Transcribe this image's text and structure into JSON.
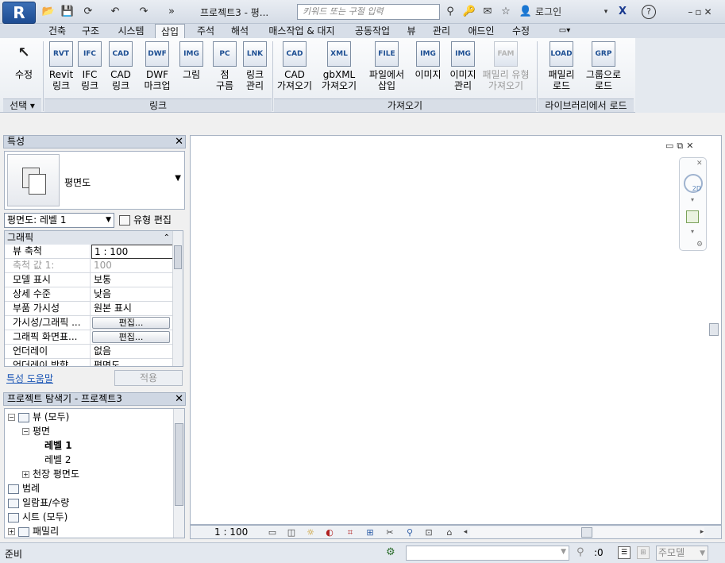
{
  "title": {
    "project": "프로젝트3 - 평...",
    "search_placeholder": "키워드 또는 구절 입력",
    "login": "로그인",
    "help": "?"
  },
  "tabs": [
    "건축",
    "구조",
    "시스템",
    "삽입",
    "주석",
    "해석",
    "매스작업 & 대지",
    "공동작업",
    "뷰",
    "관리",
    "애드인",
    "수정"
  ],
  "active_tab": "삽입",
  "ribbon": {
    "modify": "수정",
    "modify_panel": "선택 ▾",
    "link_buttons": [
      {
        "label": "Revit\n링크",
        "icon": "RVT"
      },
      {
        "label": "IFC\n링크",
        "icon": "IFC"
      },
      {
        "label": "CAD\n링크",
        "icon": "CAD"
      },
      {
        "label": "DWF\n마크업",
        "icon": "DWF"
      },
      {
        "label": "그림",
        "icon": "IMG"
      },
      {
        "label": "점\n구름",
        "icon": "PC"
      },
      {
        "label": "링크\n관리",
        "icon": "LNK"
      }
    ],
    "link_panel": "링크",
    "import_buttons": [
      {
        "label": "CAD\n가져오기",
        "icon": "CAD"
      },
      {
        "label": "gbXML\n가져오기",
        "icon": "XML"
      },
      {
        "label": "파일에서\n삽입",
        "icon": "FILE"
      },
      {
        "label": "이미지",
        "icon": "IMG"
      },
      {
        "label": "이미지\n관리",
        "icon": "IMG"
      },
      {
        "label": "패밀리 유형\n가져오기",
        "icon": "FAM",
        "disabled": true
      }
    ],
    "import_panel": "가져오기",
    "library_buttons": [
      {
        "label": "패밀리\n로드",
        "icon": "LOAD"
      },
      {
        "label": "그룹으로\n로드",
        "icon": "GRP"
      }
    ],
    "library_panel": "라이브러리에서 로드"
  },
  "properties": {
    "header": "특성",
    "type_name": "평면도",
    "instance_selector": "평면도: 레벨 1",
    "edit_type": "유형 편집",
    "group": "그래픽",
    "rows": [
      {
        "name": "뷰 축척",
        "value": "1 : 100",
        "boxed": true
      },
      {
        "name": "축척 값    1:",
        "value": "100",
        "dim": true
      },
      {
        "name": "모델 표시",
        "value": "보통"
      },
      {
        "name": "상세 수준",
        "value": "낮음"
      },
      {
        "name": "부품 가시성",
        "value": "원본 표시"
      },
      {
        "name": "가시성/그래픽 ...",
        "value": "편집...",
        "button": true
      },
      {
        "name": "그래픽 화면표...",
        "value": "편집...",
        "button": true
      },
      {
        "name": "언더레이",
        "value": "없음"
      },
      {
        "name": "언더레이 방향",
        "value": "평면도"
      }
    ],
    "help": "특성 도움말",
    "apply": "적용"
  },
  "browser": {
    "header": "프로젝트 탐색기 - 프로젝트3",
    "nodes": [
      {
        "label": "뷰 (모두)",
        "depth": 0,
        "expander": "−"
      },
      {
        "label": "평면",
        "depth": 1,
        "expander": "−"
      },
      {
        "label": "레벨 1",
        "depth": 2,
        "bold": true
      },
      {
        "label": "레벨 2",
        "depth": 2
      },
      {
        "label": "천장 평면도",
        "depth": 1,
        "expander": "+"
      },
      {
        "label": "범례",
        "depth": 0
      },
      {
        "label": "일람표/수량",
        "depth": 0
      },
      {
        "label": "시트 (모두)",
        "depth": 0
      },
      {
        "label": "패밀리",
        "depth": 0,
        "expander": "+"
      }
    ]
  },
  "view": {
    "scale": "1 : 100"
  },
  "status": {
    "text": "준비",
    "selection_count": ":0",
    "model": "주모델"
  }
}
